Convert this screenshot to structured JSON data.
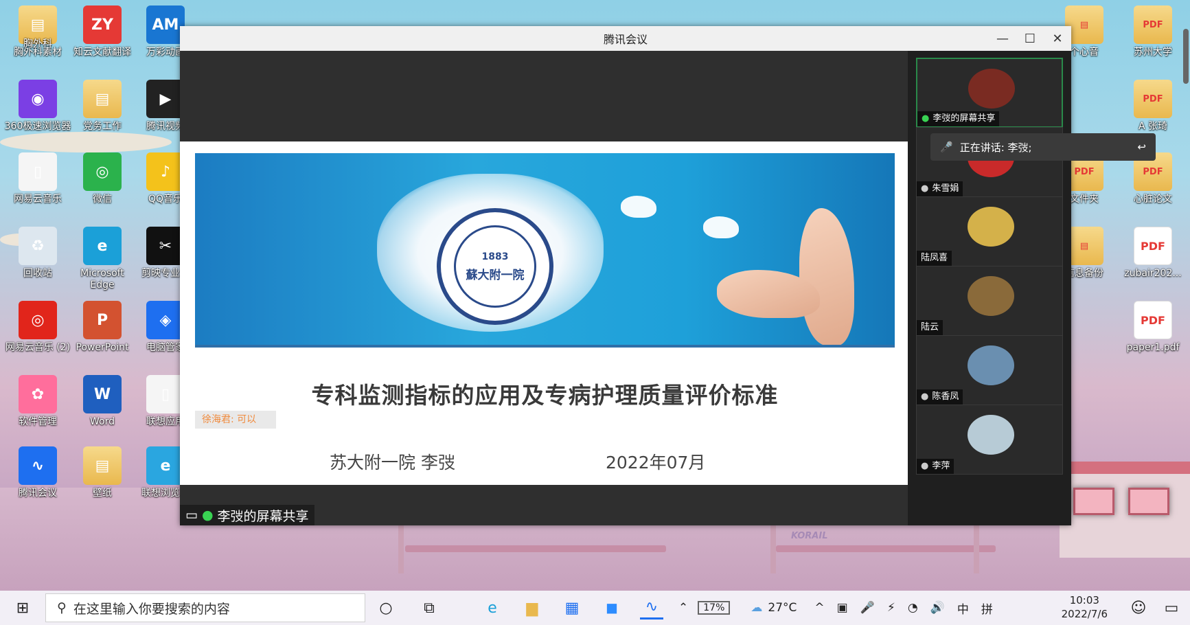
{
  "window": {
    "title": "腾讯会议",
    "minimize": "—",
    "maximize": "☐",
    "close": "✕"
  },
  "slide": {
    "title": "专科监测指标的应用及专病护理质量评价标准",
    "presenter": "苏大附一院  李弢",
    "date": "2022年07月",
    "seal_top": "1883",
    "seal_middle": "蘇大附一院",
    "chat_text": "徐海君: 可以"
  },
  "share_label": "李弢的屏幕共享",
  "speaking": "正在讲话: 李弢;",
  "participants": [
    {
      "name": "李弢的屏幕共享",
      "avatar_color": "#7a2b22"
    },
    {
      "name": "朱雪娟",
      "avatar_color": "#c92a2a"
    },
    {
      "name": "陆凤喜",
      "avatar_color": "#d4b14a"
    },
    {
      "name": "陆云",
      "avatar_color": "#8a6a3a"
    },
    {
      "name": "陈香凤",
      "avatar_color": "#6a8fb0"
    },
    {
      "name": "李萍",
      "avatar_color": "#b7cbd6"
    }
  ],
  "desktop_icons_left": [
    {
      "label": "胸外科素材",
      "glyph": "▤",
      "kind": "folder"
    },
    {
      "label": "知云文献翻译",
      "glyph": "ZY",
      "kind": "app",
      "color": "#e53935"
    },
    {
      "label": "万彩动画",
      "glyph": "AM",
      "kind": "app",
      "color": "#1976d2"
    },
    {
      "label": "360极速浏览器",
      "glyph": "◉",
      "kind": "app",
      "color": "#7b3fe4"
    },
    {
      "label": "党务工作",
      "glyph": "▤",
      "kind": "folder"
    },
    {
      "label": "腾讯视频",
      "glyph": "▶",
      "kind": "app",
      "color": "#222"
    },
    {
      "label": "网易云音乐",
      "glyph": "▯",
      "kind": "app",
      "color": "#f5f5f5"
    },
    {
      "label": "微信",
      "glyph": "◎",
      "kind": "app",
      "color": "#2bb24c"
    },
    {
      "label": "QQ音乐",
      "glyph": "♪",
      "kind": "app",
      "color": "#f4c21b"
    },
    {
      "label": "回收站",
      "glyph": "♻",
      "kind": "app",
      "color": "#dde7ef"
    },
    {
      "label": "Microsoft Edge",
      "glyph": "e",
      "kind": "app",
      "color": "#1ba0d8"
    },
    {
      "label": "剪映专业版",
      "glyph": "✂",
      "kind": "app",
      "color": "#111"
    },
    {
      "label": "网易云音乐 (2)",
      "glyph": "◎",
      "kind": "app",
      "color": "#e1251b"
    },
    {
      "label": "PowerPoint",
      "glyph": "P",
      "kind": "app",
      "color": "#d35230"
    },
    {
      "label": "电脑管家",
      "glyph": "◈",
      "kind": "app",
      "color": "#1e6ff0"
    },
    {
      "label": "软件管理",
      "glyph": "✿",
      "kind": "app",
      "color": "#ff6e9c"
    },
    {
      "label": "Word",
      "glyph": "W",
      "kind": "app",
      "color": "#1f5fbf"
    },
    {
      "label": "联想应用",
      "glyph": "▯",
      "kind": "app",
      "color": "#f5f5f5"
    },
    {
      "label": "腾讯会议",
      "glyph": "∿",
      "kind": "app",
      "color": "#1e6ff0"
    },
    {
      "label": "壁纸",
      "glyph": "▤",
      "kind": "folder"
    },
    {
      "label": "联想浏览器",
      "glyph": "e",
      "kind": "app",
      "color": "#2aa6e0"
    },
    {
      "label": "胸外科",
      "glyph": "",
      "kind": "none"
    }
  ],
  "desktop_icons_right": [
    {
      "label": "个心音",
      "glyph": "▤",
      "kind": "folder"
    },
    {
      "label": "苏州大学",
      "glyph": "PDF",
      "kind": "folder"
    },
    {
      "label": "A 张琦",
      "glyph": "PDF",
      "kind": "folder"
    },
    {
      "label": "文件夹",
      "glyph": "PDF",
      "kind": "folder"
    },
    {
      "label": "心脏论文",
      "glyph": "PDF",
      "kind": "folder"
    },
    {
      "label": "信息备份",
      "glyph": "▤",
      "kind": "folder"
    },
    {
      "label": "zubair202...",
      "glyph": "PDF",
      "kind": "pdf"
    },
    {
      "label": "paper1.pdf",
      "glyph": "PDF",
      "kind": "pdf"
    }
  ],
  "taskbar": {
    "search_placeholder": "在这里输入你要搜索的内容",
    "battery": "17%",
    "weather": "27°C",
    "ime": "中",
    "ime2": "拼",
    "time": "10:03",
    "date": "2022/7/6"
  },
  "wallpaper_sign": "KORAIL"
}
